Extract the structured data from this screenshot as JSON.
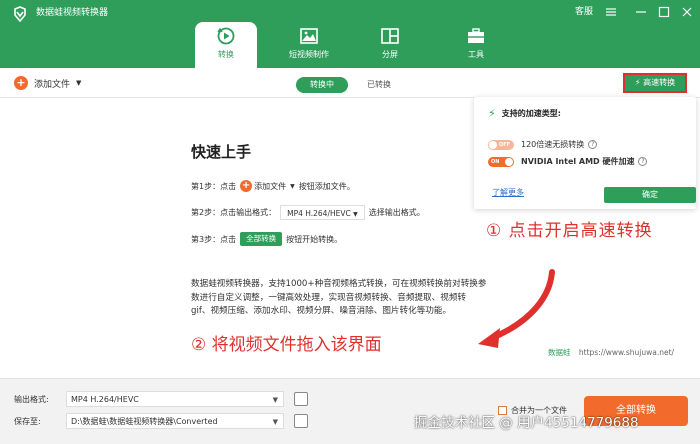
{
  "app": {
    "title": "数据蛙视频转换器",
    "accent": "#2f9e5b",
    "orange": "#f26b2c",
    "red": "#e0302e"
  },
  "window": {
    "customer_service": "客服",
    "menu_icon": "hamburger-icon",
    "minimize_icon": "minimize-icon",
    "maximize_icon": "maximize-icon",
    "close_icon": "close-icon"
  },
  "nav_tabs": [
    {
      "label": "转换",
      "icon": "convert-icon",
      "active": true
    },
    {
      "label": "短视频制作",
      "icon": "image-icon",
      "active": false
    },
    {
      "label": "分屏",
      "icon": "split-screen-icon",
      "active": false
    },
    {
      "label": "工具",
      "icon": "toolbox-icon",
      "active": false
    }
  ],
  "toolbar": {
    "add_file": "添加文件",
    "seg_converting": "转换中",
    "seg_converted": "已转换",
    "accel_button": "高速转换"
  },
  "accel_popup": {
    "title": "支持的加速类型:",
    "option1_toggle": "OFF",
    "option1_label": "120倍速无损转换",
    "option2_toggle": "ON",
    "option2_label": "NVIDIA  Intel  AMD 硬件加速",
    "learn_more": "了解更多",
    "confirm": "确定"
  },
  "annotations": {
    "step1_note": "① 点击开启高速转换",
    "step2_note": "② 将视频文件拖入该界面"
  },
  "quickstart": {
    "title": "快速上手",
    "step1_prefix": "第1步：点击",
    "step1_button": "添加文件",
    "step1_suffix": "按钮添加文件。",
    "step2_prefix": "第2步：点击输出格式：",
    "step2_format": "MP4 H.264/HEVC",
    "step2_suffix": "选择输出格式。",
    "step3_prefix": "第3步：点击",
    "step3_button": "全部转换",
    "step3_suffix": "按钮开始转换。",
    "desc1": "数据蛙视频转换器，支持1000+种音视频格式转换，可在视频转换前对转换参",
    "desc2": "数进行自定义调整，一键高效处理，实现音视频转换、音频提取、视频转",
    "desc3": "gif、视频压缩、添加水印、视频分屏、噪音消除、图片转化等功能。"
  },
  "watermark": {
    "brand": "数据蛙",
    "url": "https://www.shujuwa.net/"
  },
  "bottom": {
    "output_format_label": "输出格式:",
    "output_format_value": "MP4 H.264/HEVC",
    "save_to_label": "保存至:",
    "save_to_value": "D:\\数据蛙\\数据蛙视频转换器\\Converted",
    "merge_label": "合并为一个文件",
    "convert_all": "全部转换"
  },
  "overlay": {
    "juejin": "掘金技术社区 @ 用户45514779688"
  }
}
